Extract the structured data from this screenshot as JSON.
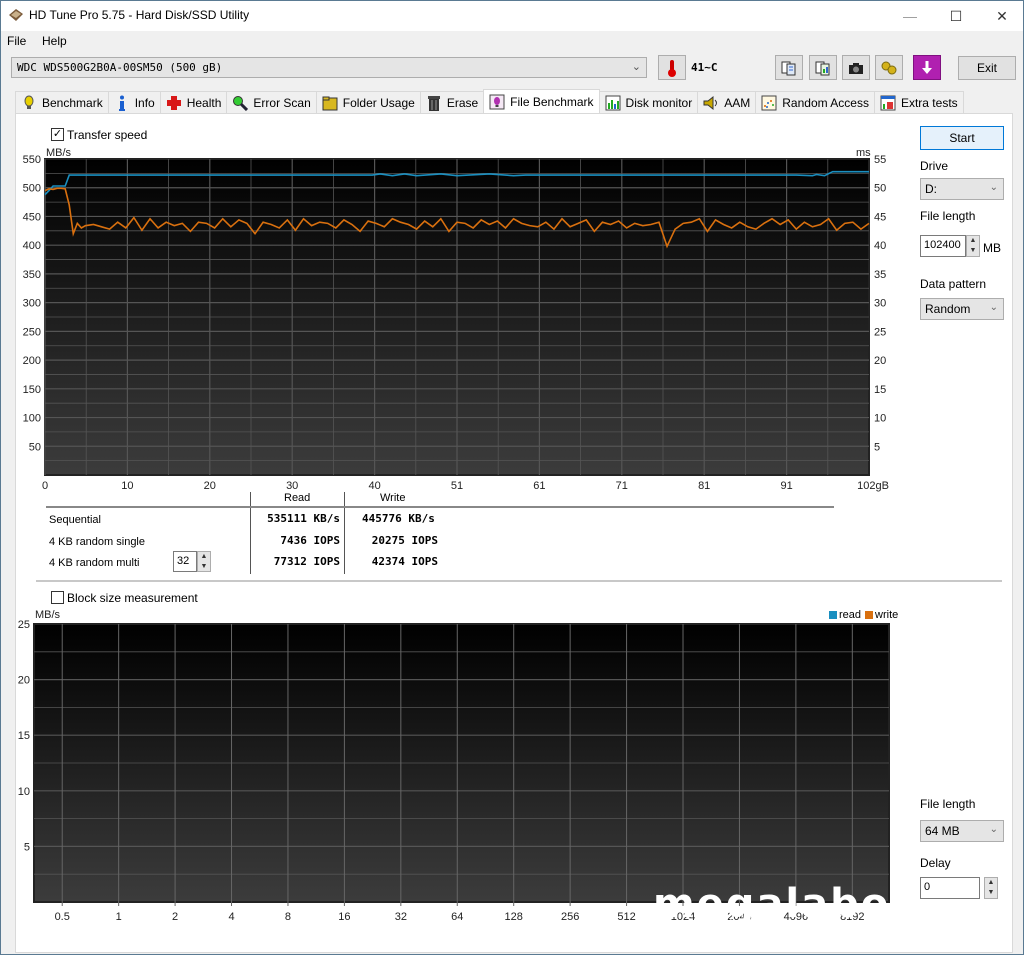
{
  "window": {
    "title": "HD Tune Pro 5.75 - Hard Disk/SSD Utility",
    "controls": {
      "minimize": "—",
      "maximize": "☐",
      "close": "✕"
    }
  },
  "menu": {
    "file": "File",
    "help": "Help"
  },
  "toolbar": {
    "drive": "WDC  WDS500G2B0A-00SM50 (500 gB)",
    "temperature": "41~C",
    "icons": [
      "copy-info-icon",
      "copy-results-icon",
      "screenshot-icon",
      "options-icon",
      "save-icon"
    ],
    "exit_label": "Exit"
  },
  "tabs": [
    {
      "label": "Benchmark",
      "icon": "bulb-icon"
    },
    {
      "label": "Info",
      "icon": "info-icon"
    },
    {
      "label": "Health",
      "icon": "health-cross-icon"
    },
    {
      "label": "Error Scan",
      "icon": "magnifier-icon"
    },
    {
      "label": "Folder Usage",
      "icon": "folder-icon"
    },
    {
      "label": "Erase",
      "icon": "trash-icon"
    },
    {
      "label": "File Benchmark",
      "icon": "file-bulb-icon",
      "active": true
    },
    {
      "label": "Disk monitor",
      "icon": "bar-chart-icon"
    },
    {
      "label": "AAM",
      "icon": "speaker-icon"
    },
    {
      "label": "Random Access",
      "icon": "scatter-icon"
    },
    {
      "label": "Extra tests",
      "icon": "window-chart-icon"
    }
  ],
  "transfer": {
    "checkbox_label": "Transfer speed",
    "checked": true
  },
  "results": {
    "col_read": "Read",
    "col_write": "Write",
    "rows": [
      {
        "label": "Sequential",
        "read": "535111 KB/s",
        "write": "445776 KB/s"
      },
      {
        "label": "4 KB random single",
        "read": "7436 IOPS",
        "write": "20275 IOPS"
      },
      {
        "label": "4 KB random multi",
        "read": "77312 IOPS",
        "write": "42374 IOPS"
      }
    ],
    "queue_depth": "32"
  },
  "side_top": {
    "start_label": "Start",
    "drive_label": "Drive",
    "drive_value": "D:",
    "file_length_label": "File length",
    "file_length_value": "102400",
    "file_length_unit": "MB",
    "data_pattern_label": "Data pattern",
    "data_pattern_value": "Random"
  },
  "block": {
    "checkbox_label": "Block size measurement",
    "checked": false
  },
  "side_bottom": {
    "file_length_label": "File length",
    "file_length_value": "64 MB",
    "delay_label": "Delay",
    "delay_value": "0"
  },
  "watermark": "megalabo",
  "chart_data": [
    {
      "type": "line",
      "title": "Transfer speed",
      "ylabel": "MB/s",
      "y2label": "ms",
      "xlabel": "gB",
      "ylim": [
        0,
        550
      ],
      "y2lim": [
        0,
        55
      ],
      "yticks": [
        "550",
        "500",
        "450",
        "400",
        "350",
        "300",
        "250",
        "200",
        "150",
        "100",
        "50"
      ],
      "y2ticks": [
        "55",
        "50",
        "45",
        "40",
        "35",
        "30",
        "25",
        "20",
        "15",
        "10",
        "5"
      ],
      "xlim": [
        0,
        102
      ],
      "xticks": [
        "0",
        "10",
        "20",
        "30",
        "40",
        "51",
        "61",
        "71",
        "81",
        "91",
        "102gB"
      ],
      "grid": true,
      "series": [
        {
          "name": "read",
          "color": "#1a8fc0",
          "x": [
            0,
            0.5,
            1,
            1.5,
            2,
            2.5,
            3,
            10,
            20,
            30,
            40.5,
            41.5,
            43,
            44.5,
            46,
            49,
            51,
            55,
            58,
            59.5,
            60,
            70,
            80,
            93,
            95,
            95.5,
            96.5,
            97.5,
            98,
            102
          ],
          "y": [
            488,
            495,
            503,
            503,
            503,
            503,
            522,
            522,
            522,
            522,
            522,
            524,
            521,
            524,
            521,
            524,
            521,
            524,
            521,
            522,
            522,
            522,
            522,
            522,
            521,
            523,
            521,
            528,
            528,
            528
          ]
        },
        {
          "name": "write",
          "color": "#d9700f",
          "x": [
            0,
            0.5,
            1,
            1.5,
            2,
            2.5,
            3,
            3.5,
            4,
            4.5,
            5,
            6,
            7,
            8,
            9,
            10,
            11,
            12,
            13,
            14,
            15,
            16,
            17,
            18,
            19,
            20,
            21,
            22,
            23,
            24,
            25,
            26,
            27,
            28,
            29,
            30,
            31,
            32,
            33,
            34,
            35,
            36,
            37,
            38,
            39,
            40,
            41,
            42,
            43,
            44,
            45,
            46,
            47,
            48,
            49,
            50,
            51,
            52,
            53,
            54,
            55,
            56,
            57,
            58,
            59,
            60,
            61,
            62,
            63,
            64,
            65,
            66,
            67,
            68,
            69,
            70,
            71,
            72,
            73,
            74,
            75,
            76,
            77,
            78,
            79,
            80,
            81,
            82,
            83,
            84,
            85,
            86,
            87,
            88,
            89,
            90,
            91,
            92,
            93,
            94,
            95,
            96,
            97,
            98,
            99,
            100,
            101,
            102
          ],
          "y": [
            495,
            498,
            497,
            499,
            499,
            498,
            470,
            420,
            438,
            430,
            434,
            436,
            432,
            428,
            440,
            430,
            448,
            426,
            446,
            430,
            440,
            434,
            438,
            424,
            440,
            438,
            430,
            446,
            432,
            444,
            438,
            420,
            440,
            436,
            430,
            444,
            426,
            446,
            434,
            440,
            438,
            430,
            444,
            436,
            424,
            442,
            438,
            432,
            446,
            440,
            436,
            428,
            442,
            432,
            446,
            424,
            440,
            438,
            430,
            444,
            436,
            442,
            430,
            446,
            438,
            434,
            432,
            440,
            428,
            446,
            432,
            438,
            444,
            424,
            440,
            436,
            442,
            430,
            438,
            434,
            436,
            440,
            398,
            428,
            438,
            440,
            446,
            424,
            444,
            436,
            430,
            440,
            432,
            428,
            438,
            446,
            436,
            444,
            428,
            440,
            432,
            436,
            446,
            426,
            438,
            440,
            428,
            438
          ]
        }
      ]
    },
    {
      "type": "bar",
      "title": "Block size measurement",
      "ylabel": "MB/s",
      "ylim": [
        0,
        25
      ],
      "yticks": [
        "25",
        "20",
        "15",
        "10",
        "5"
      ],
      "categories": [
        "0.5",
        "1",
        "2",
        "4",
        "8",
        "16",
        "32",
        "64",
        "128",
        "256",
        "512",
        "1024",
        "2048",
        "4096",
        "8192"
      ],
      "grid": true,
      "legend": "top-right",
      "series": [
        {
          "name": "read",
          "color": "#1a8fc0",
          "values": []
        },
        {
          "name": "write",
          "color": "#d9700f",
          "values": []
        }
      ]
    }
  ]
}
